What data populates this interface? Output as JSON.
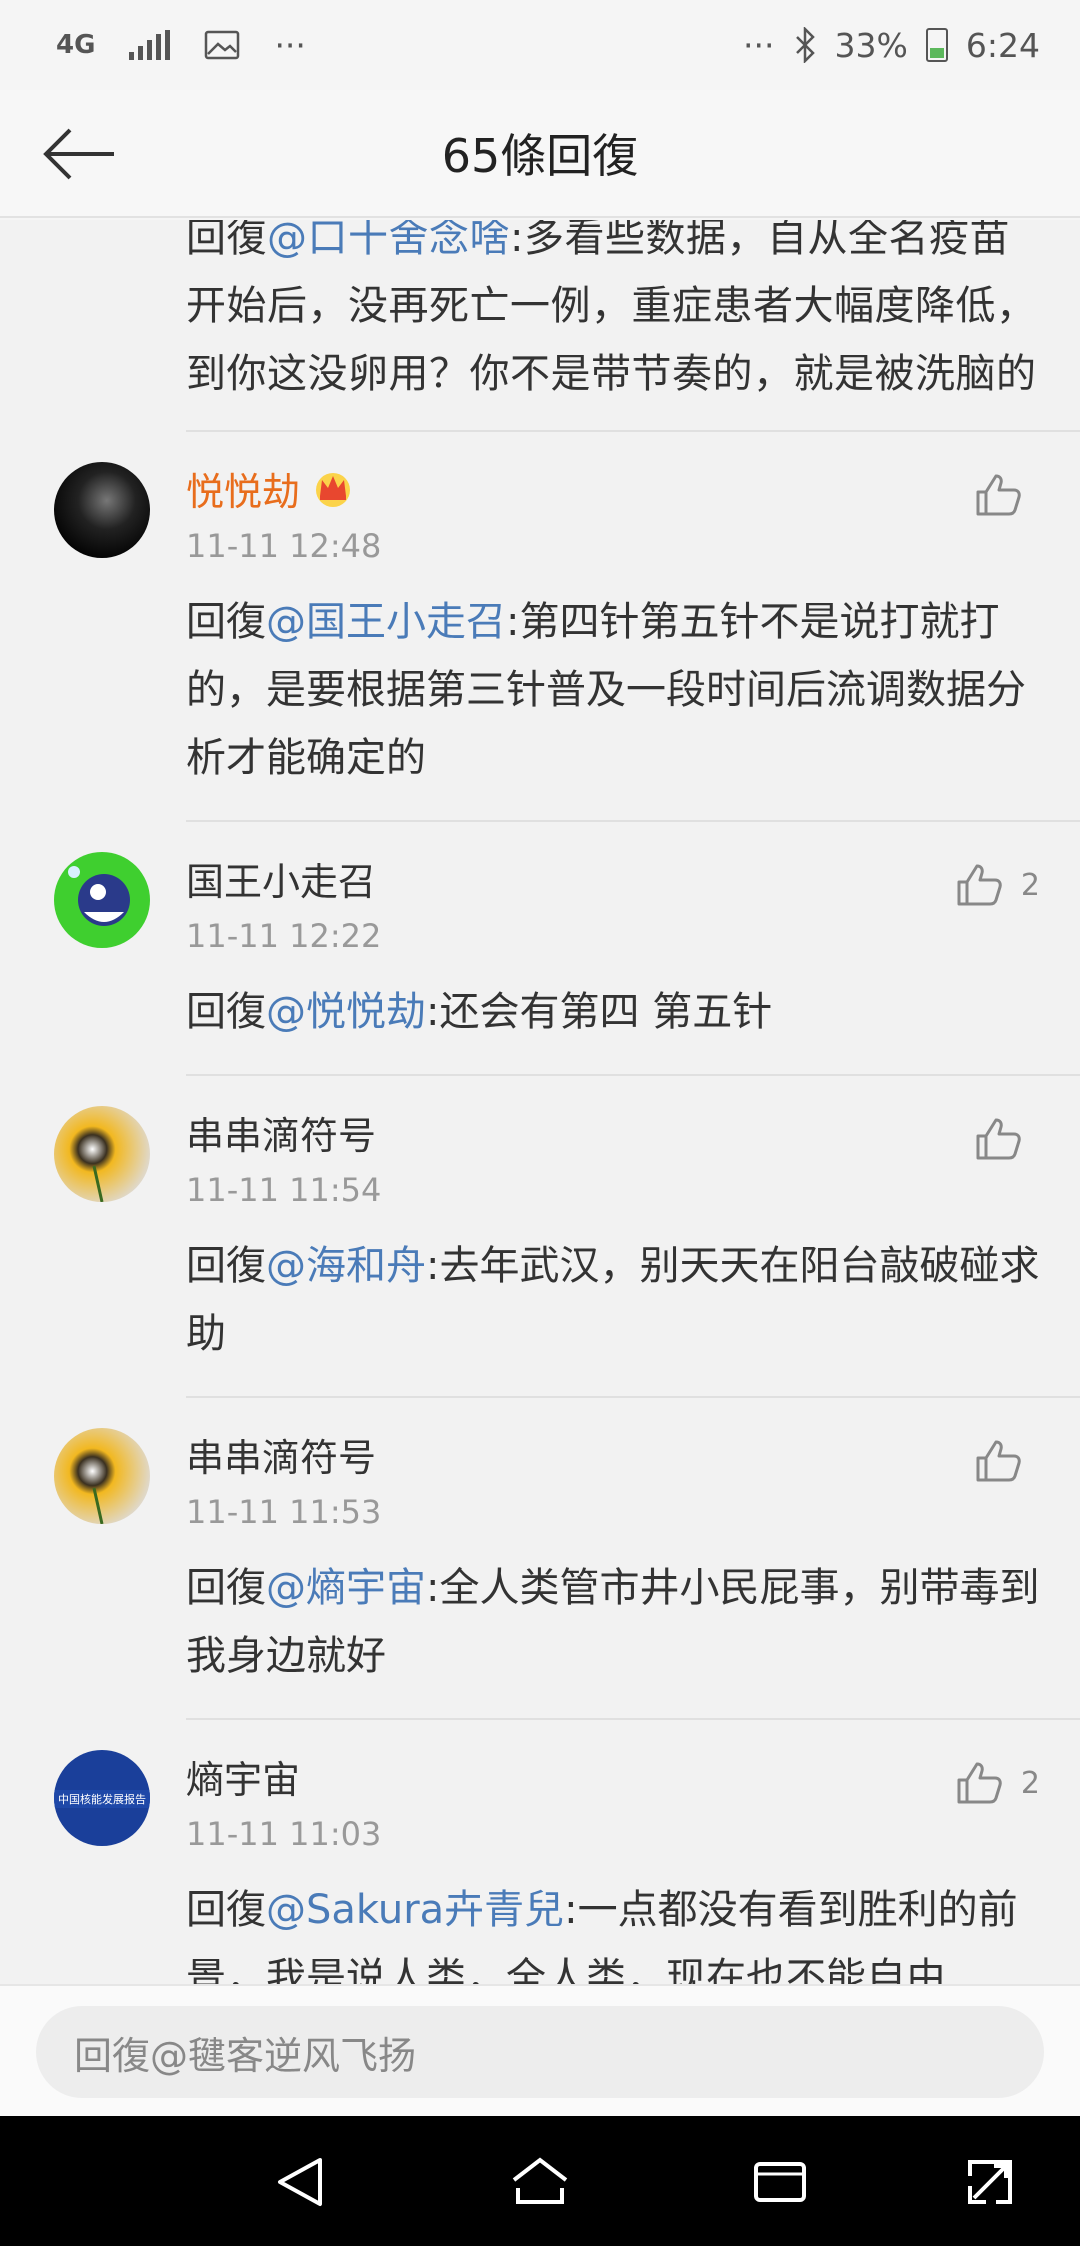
{
  "status": {
    "network": "4G",
    "more": "···",
    "more_right": "···",
    "battery": "33%",
    "time": "6:24"
  },
  "header": {
    "title": "65條回復"
  },
  "top_partial": {
    "prefix": "回復",
    "mention": "@口十舍念啥",
    "text": ":多看些数据，自从全名疫苗开始后，没再死亡一例，重症患者大幅度降低，到你这没卵用？你不是带节奏的，就是被洗脑的"
  },
  "comments": [
    {
      "name": "悦悦劫",
      "vip": true,
      "time": "11-11 12:48",
      "likes": "",
      "prefix": "回復",
      "mention": "@国王小走召",
      "text": ":第四针第五针不是说打就打的，是要根据第三针普及一段时间后流调数据分析才能确定的"
    },
    {
      "name": "国王小走召",
      "vip": false,
      "time": "11-11 12:22",
      "likes": "2",
      "prefix": "回復",
      "mention": "@悦悦劫",
      "text": ":还会有第四 第五针"
    },
    {
      "name": "串串滴符号",
      "vip": false,
      "time": "11-11 11:54",
      "likes": "",
      "prefix": "回復",
      "mention": "@海和舟",
      "text": ":去年武汉，别天天在阳台敲破碰求助"
    },
    {
      "name": "串串滴符号",
      "vip": false,
      "time": "11-11 11:53",
      "likes": "",
      "prefix": "回復",
      "mention": "@熵宇宙",
      "text": ":全人类管市井小民屁事，别带毒到我身边就好"
    },
    {
      "name": "熵宇宙",
      "vip": false,
      "time": "11-11 11:03",
      "likes": "2",
      "prefix": "回復",
      "mention": "@Sakura卉青兒",
      "text": ":一点都没有看到胜利的前景，我是说人类，全人类，现在也不能自由"
    }
  ],
  "avatar_texts": {
    "report": "中国核能发展报告"
  },
  "input": {
    "placeholder": "回復@毽客逆风飞扬"
  },
  "colors": {
    "mention": "#4a7bb8",
    "vip_name": "#e86d1c",
    "nav_background": "#000000"
  }
}
